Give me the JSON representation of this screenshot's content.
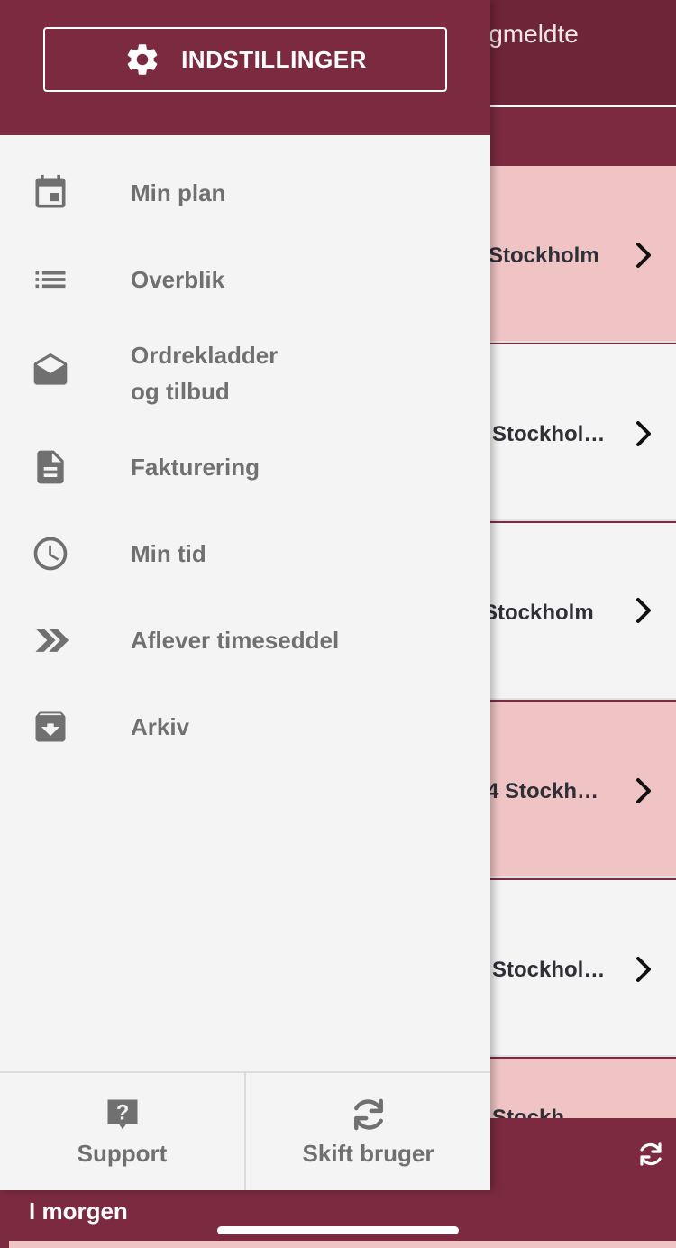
{
  "background": {
    "tab_label": "igmeldte",
    "rows": [
      {
        "text": "Stockholm",
        "tone": "pink"
      },
      {
        "text": "Stockhol…",
        "tone": "white"
      },
      {
        "text": "Stockholm",
        "tone": "white"
      },
      {
        "text": "4 Stockh…",
        "tone": "pink"
      },
      {
        "text": "Stockhol…",
        "tone": "white"
      },
      {
        "text": "Stockh…",
        "tone": "pink"
      }
    ],
    "bottom_label": "I morgen"
  },
  "drawer": {
    "settings_label": "INDSTILLINGER",
    "menu": [
      {
        "label": "Min plan",
        "icon": "calendar-icon"
      },
      {
        "label": "Overblik",
        "icon": "list-icon"
      },
      {
        "label": "Ordrekladder\nog tilbud",
        "icon": "envelope-open-icon"
      },
      {
        "label": "Fakturering",
        "icon": "document-icon"
      },
      {
        "label": "Min tid",
        "icon": "clock-icon"
      },
      {
        "label": "Aflever timeseddel",
        "icon": "double-chevron-icon"
      },
      {
        "label": "Arkiv",
        "icon": "archive-icon"
      }
    ],
    "bottom": {
      "support_label": "Support",
      "switch_user_label": "Skift bruger"
    }
  },
  "colors": {
    "brand": "#7b2a40",
    "pink_row": "#f0c4c4",
    "menu_text": "#707070"
  }
}
